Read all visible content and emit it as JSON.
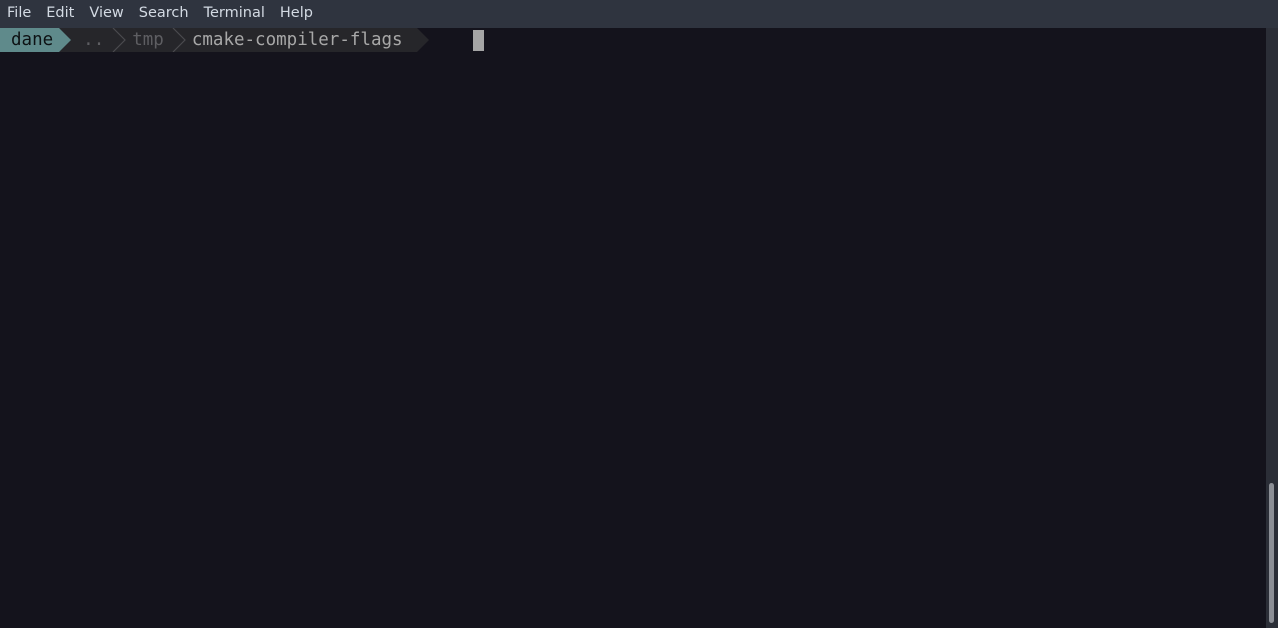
{
  "menu": {
    "items": [
      "File",
      "Edit",
      "View",
      "Search",
      "Terminal",
      "Help"
    ]
  },
  "prompt": {
    "user": "dane",
    "path": [
      "..",
      "tmp"
    ],
    "cwd": "cmake-compiler-flags"
  },
  "colors": {
    "background": "#14131c",
    "menubar": "#2f343f",
    "user_segment": "#5f8a8b",
    "path_segment": "#26262a",
    "cursor": "#a5a5a5"
  }
}
